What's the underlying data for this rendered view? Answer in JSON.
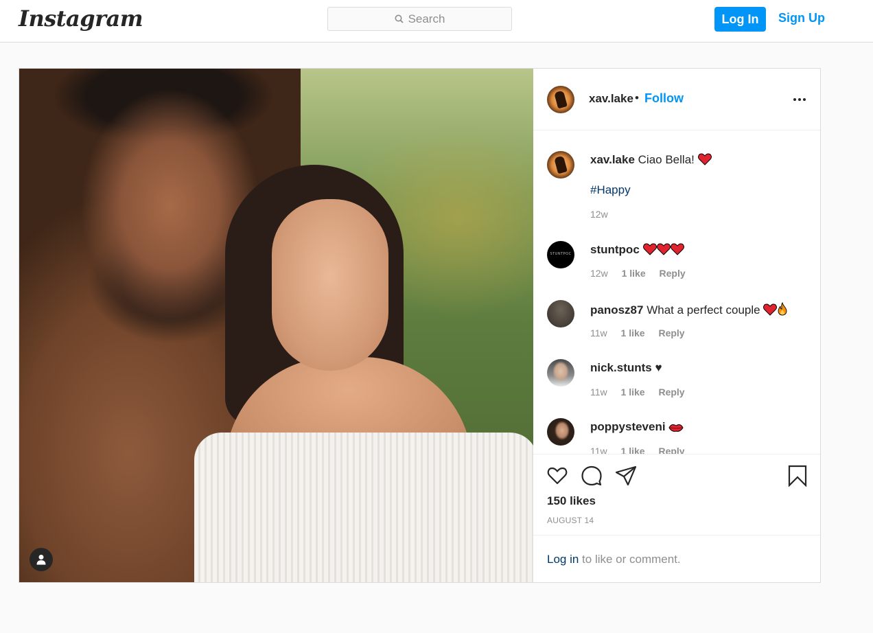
{
  "nav": {
    "logo": "Instagram",
    "search_placeholder": "Search",
    "login_label": "Log In",
    "signup_label": "Sign Up"
  },
  "post": {
    "author": "xav.lake",
    "follow_separator": "•",
    "follow_label": "Follow",
    "caption": {
      "username": "xav.lake",
      "text": "Ciao Bella!",
      "emoji": "heart-emoji",
      "hashtag": "#Happy",
      "time": "12w"
    },
    "comments": [
      {
        "username": "stuntpoc",
        "text": "",
        "emoji": [
          "heart-emoji",
          "heart-emoji",
          "heart-emoji"
        ],
        "time": "12w",
        "likes": "1 like",
        "reply": "Reply"
      },
      {
        "username": "panosz87",
        "text": "What a perfect couple",
        "emoji": [
          "heart-emoji",
          "fire-emoji"
        ],
        "time": "11w",
        "likes": "1 like",
        "reply": "Reply"
      },
      {
        "username": "nick.stunts",
        "text": "♥",
        "emoji": [],
        "time": "11w",
        "likes": "1 like",
        "reply": "Reply"
      },
      {
        "username": "poppysteveni",
        "text": "",
        "emoji": [
          "kiss-lips-emoji"
        ],
        "time": "11w",
        "likes": "1 like",
        "reply": "Reply"
      }
    ],
    "likes": "150 likes",
    "date": "AUGUST 14",
    "login_prompt_link": "Log in",
    "login_prompt_text": " to like or comment."
  },
  "colors": {
    "accent": "#0095f6",
    "link_dark": "#00376b",
    "border": "#dbdbdb",
    "muted": "#8e8e8e",
    "heart": "#ed4956"
  }
}
